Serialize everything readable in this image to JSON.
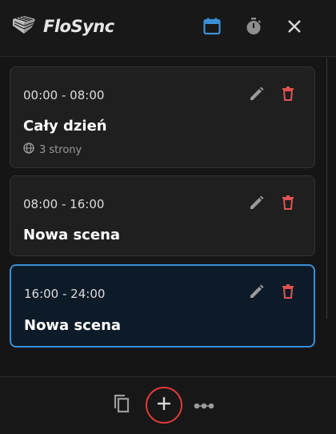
{
  "header": {
    "app_name": "FloSync",
    "icons": [
      "logo-icon",
      "calendar-icon",
      "stopwatch-icon",
      "close-icon"
    ],
    "accent": "#3b8fd6"
  },
  "scenes": [
    {
      "time": "00:00 - 08:00",
      "title": "Cały dzień",
      "meta": "3 strony",
      "active": false
    },
    {
      "time": "08:00 - 16:00",
      "title": "Nowa scena",
      "meta": "",
      "active": false
    },
    {
      "time": "16:00 - 24:00",
      "title": "Nowa scena",
      "meta": "",
      "active": true
    }
  ],
  "card_icons": [
    "edit-icon",
    "delete-icon",
    "globe-icon"
  ],
  "footer": {
    "icons": [
      "copy-icon",
      "add-icon",
      "more-icon"
    ],
    "highlight_color": "#e03a3a"
  },
  "colors": {
    "delete": "#e05252",
    "active_border": "#3b8fd6",
    "active_bg": "#0d1b28"
  }
}
